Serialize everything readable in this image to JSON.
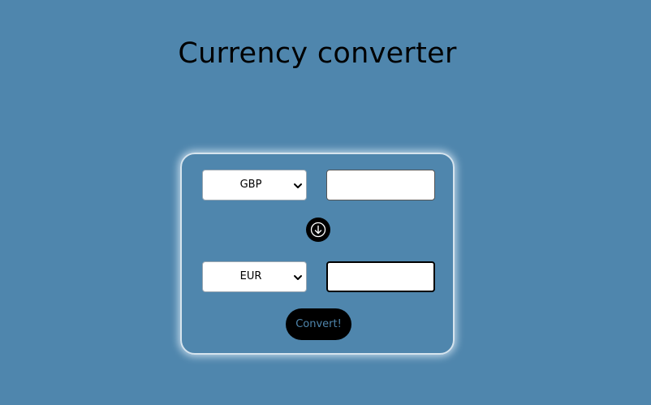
{
  "page": {
    "title": "Currency converter"
  },
  "converter": {
    "from_currency": "GBP",
    "to_currency": "EUR",
    "from_amount": "",
    "to_amount": "",
    "swap_icon": "arrow-down-icon",
    "convert_label": "Convert!"
  },
  "colors": {
    "background": "#4f86ad",
    "button_background": "#000000",
    "button_text": "#4f86ad",
    "card_border": "#d6e4ee"
  }
}
